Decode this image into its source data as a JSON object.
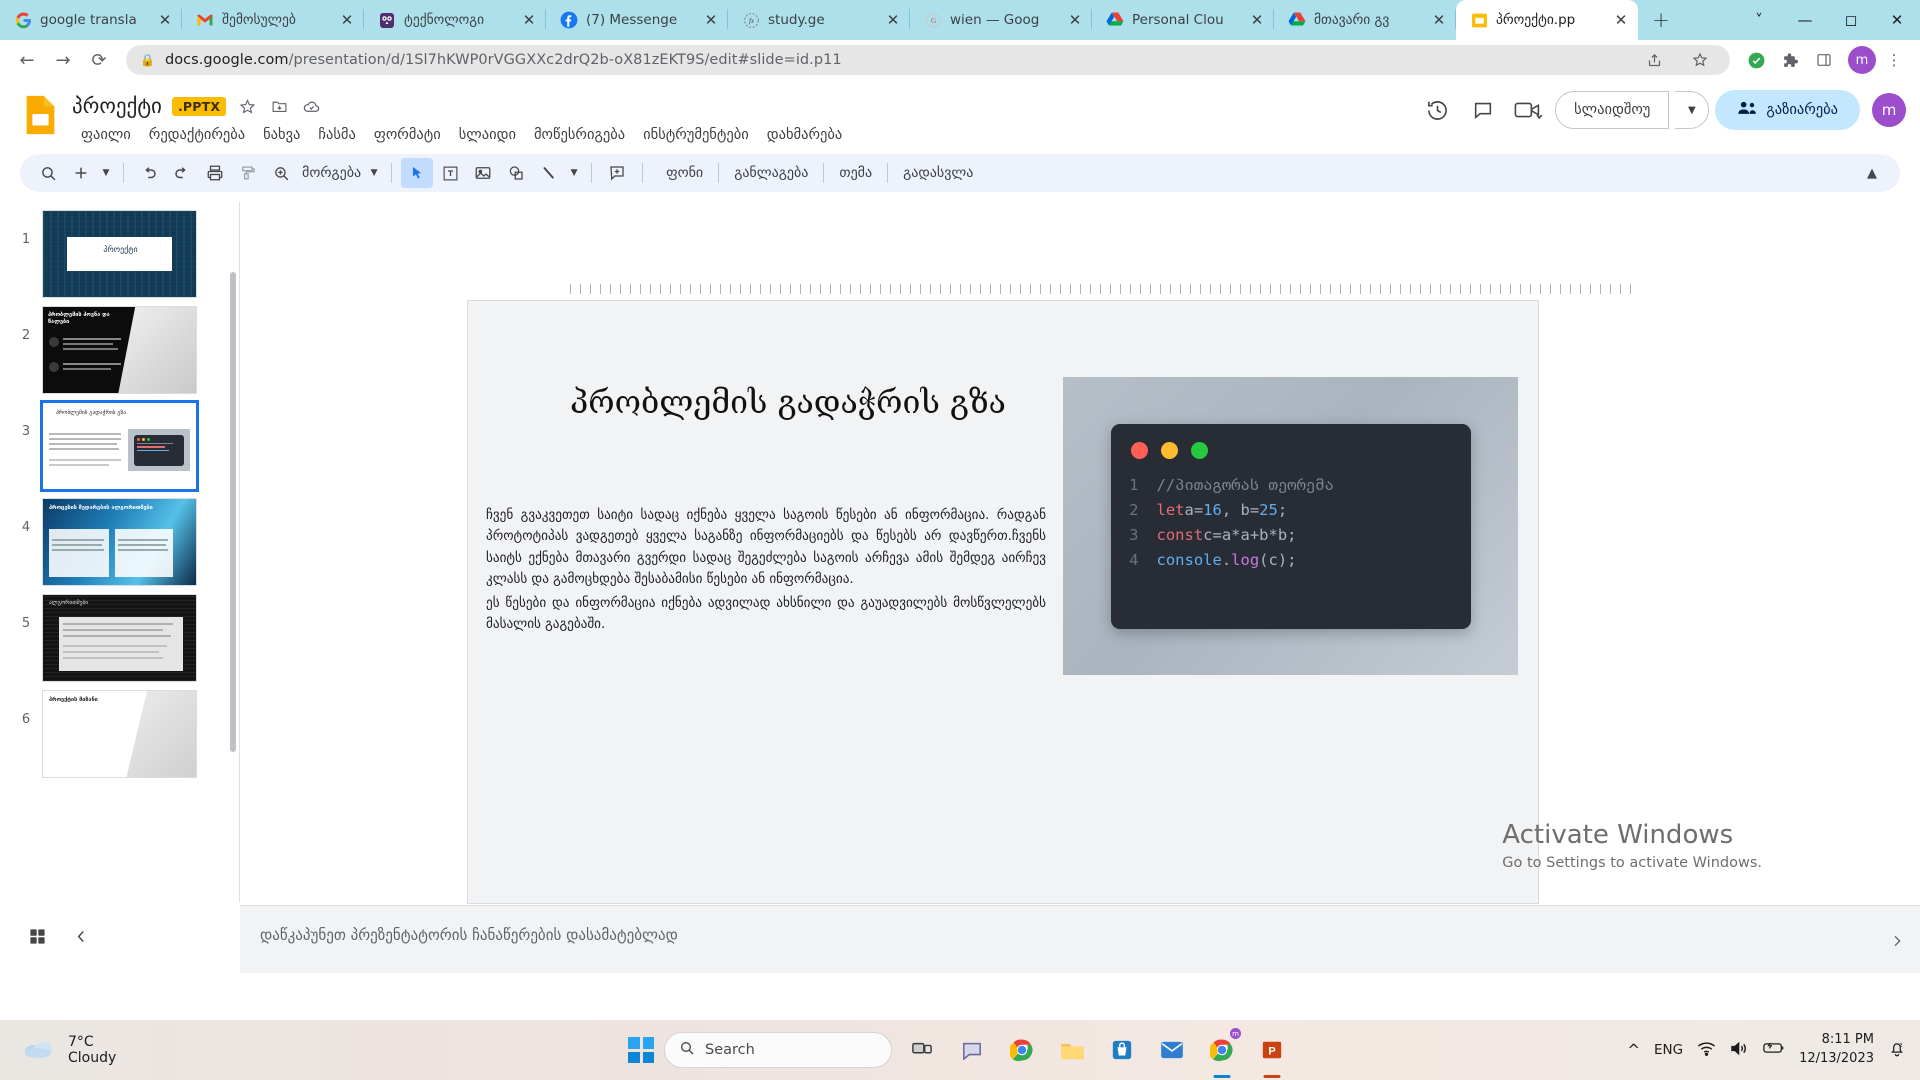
{
  "browser": {
    "tabs": [
      {
        "title": "google transla",
        "favicon": "google-icon",
        "active": false
      },
      {
        "title": "შემოსულებ",
        "favicon": "gmail-icon",
        "active": false
      },
      {
        "title": "ტექნოლოგი",
        "favicon": "owl-icon",
        "active": false
      },
      {
        "title": "(7) Messenge",
        "favicon": "facebook-icon",
        "active": false
      },
      {
        "title": "study.ge",
        "favicon": "fx-icon",
        "active": false
      },
      {
        "title": "wien — Goog",
        "favicon": "google-circle-icon",
        "active": false
      },
      {
        "title": "Personal Clou",
        "favicon": "drive-icon",
        "active": false
      },
      {
        "title": "მთავარი გვ",
        "favicon": "drive-icon",
        "active": false
      },
      {
        "title": "პროექტი.pp",
        "favicon": "slides-icon",
        "active": true
      }
    ],
    "new_tab_label": "+",
    "window_controls": {
      "minimize": "–",
      "maximize": "❐",
      "close": "✕"
    },
    "nav": {
      "back": "←",
      "forward": "→",
      "reload": "⟳"
    },
    "url": {
      "lock": "lock-icon",
      "host": "docs.google.com",
      "path": "/presentation/d/1Sl7hKWP0rVGGXXc2drQ2b-oX81zEKT9S/edit#slide=id.p11"
    },
    "omni_icons": [
      "share-icon",
      "bookmark-star-icon",
      "extension-puzzle-icon",
      "sidepanel-icon",
      "profile-avatar",
      "more-menu-icon"
    ],
    "profile_initial": "m"
  },
  "slides": {
    "doc_title": "პროექტი",
    "file_badge": ".PPTX",
    "header_icons": [
      "star-icon",
      "move-to-folder-icon",
      "cloud-saved-icon"
    ],
    "menu": [
      "ფაილი",
      "რედაქტირება",
      "ნახვა",
      "ჩასმა",
      "ფორმატი",
      "სლაიდი",
      "მოწესრიგება",
      "ინსტრუმენტები",
      "დახმარება"
    ],
    "header_right": {
      "history_icon": "version-history-icon",
      "comment_icon": "comment-icon",
      "meet_icon": "meet-camera-icon",
      "slideshow_label": "სლაიდშოუ",
      "share_label": "გაზიარება",
      "account_initial": "m"
    },
    "toolbar": {
      "zoom_label": "მორგება",
      "icons": [
        "search-icon",
        "new-slide-icon",
        "undo-icon",
        "redo-icon",
        "print-icon",
        "paint-format-icon",
        "zoom-icon",
        "select-cursor-icon",
        "text-box-icon",
        "insert-image-icon",
        "shape-icon",
        "line-icon",
        "comment-add-icon",
        "collapse-toolbar-icon"
      ],
      "labels": [
        "ფონი",
        "განლაგება",
        "თემა",
        "გადასვლა"
      ]
    },
    "filmstrip": {
      "slides": [
        {
          "num": "1",
          "kind": "title-dark",
          "caption": "პროექტი",
          "selected": false
        },
        {
          "num": "2",
          "kind": "dark-text",
          "caption": "პრობლემის პოვნა და წალები",
          "selected": false
        },
        {
          "num": "3",
          "kind": "light-code",
          "caption": "პრობლემის გადაჭრის გზა",
          "selected": true
        },
        {
          "num": "4",
          "kind": "blue-tech",
          "caption": "პროცესის შედარების ალგორითმები",
          "selected": false
        },
        {
          "num": "5",
          "kind": "dark-code",
          "caption": "ალგორითმები",
          "selected": false
        },
        {
          "num": "6",
          "kind": "light-partial",
          "caption": "პროექტის მიზანი",
          "selected": false
        }
      ]
    },
    "slide": {
      "title": "პრობლემის გადაჭრის გზა",
      "body_p1": "ჩვენ გვაკვეთეთ საიტი სადაც იქნება ყველა საგოის წესები ან ინფორმაცია. რადგან პროტოტიპას ვადგეთებ ყველა საგანზე ინფორმაციებს და წესებს არ დავწერთ.ჩვენს საიტს ექნება მთავარი გვერდი სადაც შეგეძლება საგოის არჩევა  ამის შემდეგ აირჩევ კლასს და გამოცხდება შესაბამისი წესები ან ინფორმაცია.",
      "body_p2": "ეს წესები და ინფორმაცია იქნება ადვილად ახსნილი და გაუადვილებს მოსწვლელებს მასალის გაგებაში.",
      "code": {
        "dots": [
          "#ff5f57",
          "#febc2e",
          "#28c840"
        ],
        "lines": [
          {
            "num": "1",
            "tokens": [
              {
                "t": "//პითაგორას  თეორემა",
                "c": "k-comment"
              }
            ]
          },
          {
            "num": "2",
            "tokens": [
              {
                "t": "let ",
                "c": "k-kw"
              },
              {
                "t": "a=",
                "c": "k-plain"
              },
              {
                "t": "16",
                "c": "k-num"
              },
              {
                "t": ", b=",
                "c": "k-plain"
              },
              {
                "t": "25",
                "c": "k-num"
              },
              {
                "t": ";",
                "c": "k-plain"
              }
            ]
          },
          {
            "num": "3",
            "tokens": [
              {
                "t": "const ",
                "c": "k-kw"
              },
              {
                "t": "c=a*a+b*b;",
                "c": "k-plain"
              }
            ]
          },
          {
            "num": "4",
            "tokens": [
              {
                "t": "console",
                "c": "k-fn"
              },
              {
                "t": ".",
                "c": "k-plain"
              },
              {
                "t": "log",
                "c": "k-prop"
              },
              {
                "t": "(c);",
                "c": "k-plain"
              }
            ]
          }
        ]
      }
    },
    "notes_placeholder": "დაწკაპუნეთ პრეზენტატორის ჩანაწერების დასამატებლად",
    "bottom_controls": [
      "grid-view-icon",
      "collapse-filmstrip-icon"
    ]
  },
  "watermark": {
    "line1": "Activate Windows",
    "line2": "Go to Settings to activate Windows."
  },
  "taskbar": {
    "weather": {
      "temp": "7°C",
      "condition": "Cloudy",
      "icon": "cloud-icon"
    },
    "start_label": "start-button",
    "search_placeholder": "Search",
    "apps": [
      "task-view-icon",
      "chat-icon",
      "chrome-icon",
      "file-explorer-icon",
      "store-icon",
      "mail-icon",
      "chrome-active-icon",
      "powerpoint-icon"
    ],
    "tray": {
      "chevron": "^",
      "language": "ENG",
      "wifi": "wifi-icon",
      "volume": "volume-icon",
      "battery": "battery-icon",
      "time": "8:11 PM",
      "date": "12/13/2023",
      "notification": "notification-bell-icon"
    }
  },
  "colors": {
    "tabstrip": "#aee0ec",
    "accent_blue": "#1a73e8",
    "share_bg": "#c2e7ff",
    "pptx_badge": "#fbbc04",
    "toolbar_bg": "#edf2fc"
  }
}
